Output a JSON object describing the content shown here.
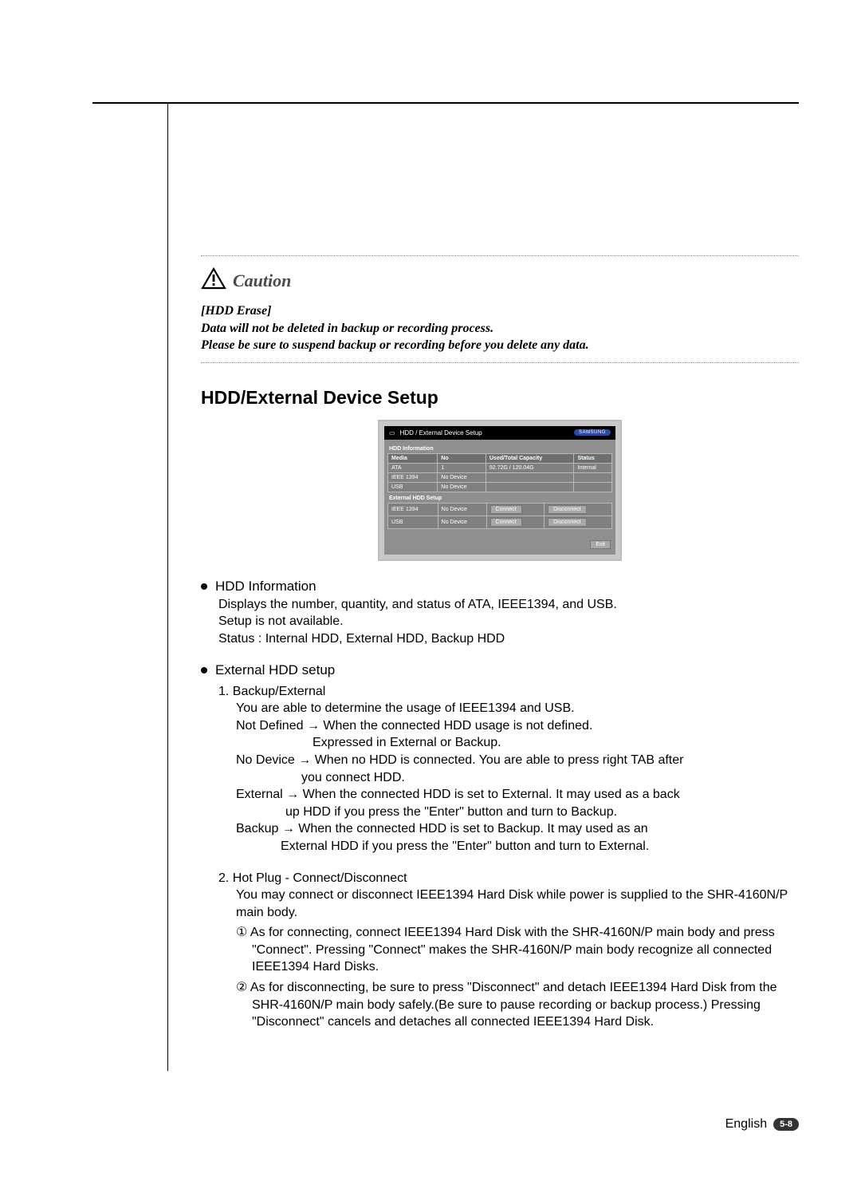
{
  "caution": {
    "label": "Caution",
    "line1": "[HDD Erase]",
    "line2": "Data will not be deleted in backup or recording process.",
    "line3": "Please be sure to suspend backup or recording before you delete any data."
  },
  "heading": "HDD/External Device Setup",
  "ui": {
    "title": "HDD / External Device Setup",
    "brand": "SAMSUNG",
    "info_caption": "HDD Information",
    "info_headers": {
      "media": "Media",
      "no": "No",
      "cap": "Used/Total Capacity",
      "status": "Status"
    },
    "info_rows": [
      {
        "media": "ATA",
        "no": "1",
        "cap": "92.72G / 120.04G",
        "status": "Internal"
      },
      {
        "media": "IEEE 1394",
        "no": "No Device",
        "cap": "",
        "status": ""
      },
      {
        "media": "USB",
        "no": "No Device",
        "cap": "",
        "status": ""
      }
    ],
    "ext_caption": "External HDD Setup",
    "ext_rows": [
      {
        "media": "IEEE 1394",
        "no": "No Device"
      },
      {
        "media": "USB",
        "no": "No Device"
      }
    ],
    "connect": "Connect",
    "disconnect": "Disconnect",
    "exit": "Exit"
  },
  "s1": {
    "title": "HDD Information",
    "p1": "Displays the number, quantity, and status of ATA, IEEE1394, and USB.",
    "p2": "Setup is not available.",
    "p3": "Status : Internal HDD, External HDD, Backup HDD"
  },
  "s2": {
    "title": "External HDD setup",
    "n1": "1. Backup/External",
    "n1a": "You are able to determine the usage of IEEE1394 and USB.",
    "nd1": "Not Defined → When the connected HDD usage is not defined.",
    "nd1b": "Expressed in External or Backup.",
    "nd2": "No Device → When no HDD is connected. You are able to press right TAB after",
    "nd2b": "you connect HDD.",
    "ext1": "External → When the connected HDD is set to External. It may used as a back",
    "ext1b": "up HDD if you press the \"Enter\" button and turn to Backup.",
    "bak1": "Backup → When the connected HDD is set to Backup. It may used as an",
    "bak1b": "External HDD if you press the \"Enter\" button and turn to External.",
    "n2": "2. Hot Plug - Connect/Disconnect",
    "n2a": "You may connect or disconnect IEEE1394 Hard Disk while power is supplied to the SHR-4160N/P main body.",
    "c1": "① As for connecting, connect IEEE1394 Hard Disk with the SHR-4160N/P main body and press \"Connect\". Pressing \"Connect\" makes the SHR-4160N/P main body recognize all connected IEEE1394 Hard Disks.",
    "c2": "② As for disconnecting, be sure to press \"Disconnect\" and detach IEEE1394 Hard Disk from the SHR-4160N/P main body safely.(Be sure to pause recording or backup process.) Pressing \"Disconnect\" cancels and detaches all connected IEEE1394 Hard Disk."
  },
  "footer": {
    "lang": "English",
    "page": "5-8"
  }
}
